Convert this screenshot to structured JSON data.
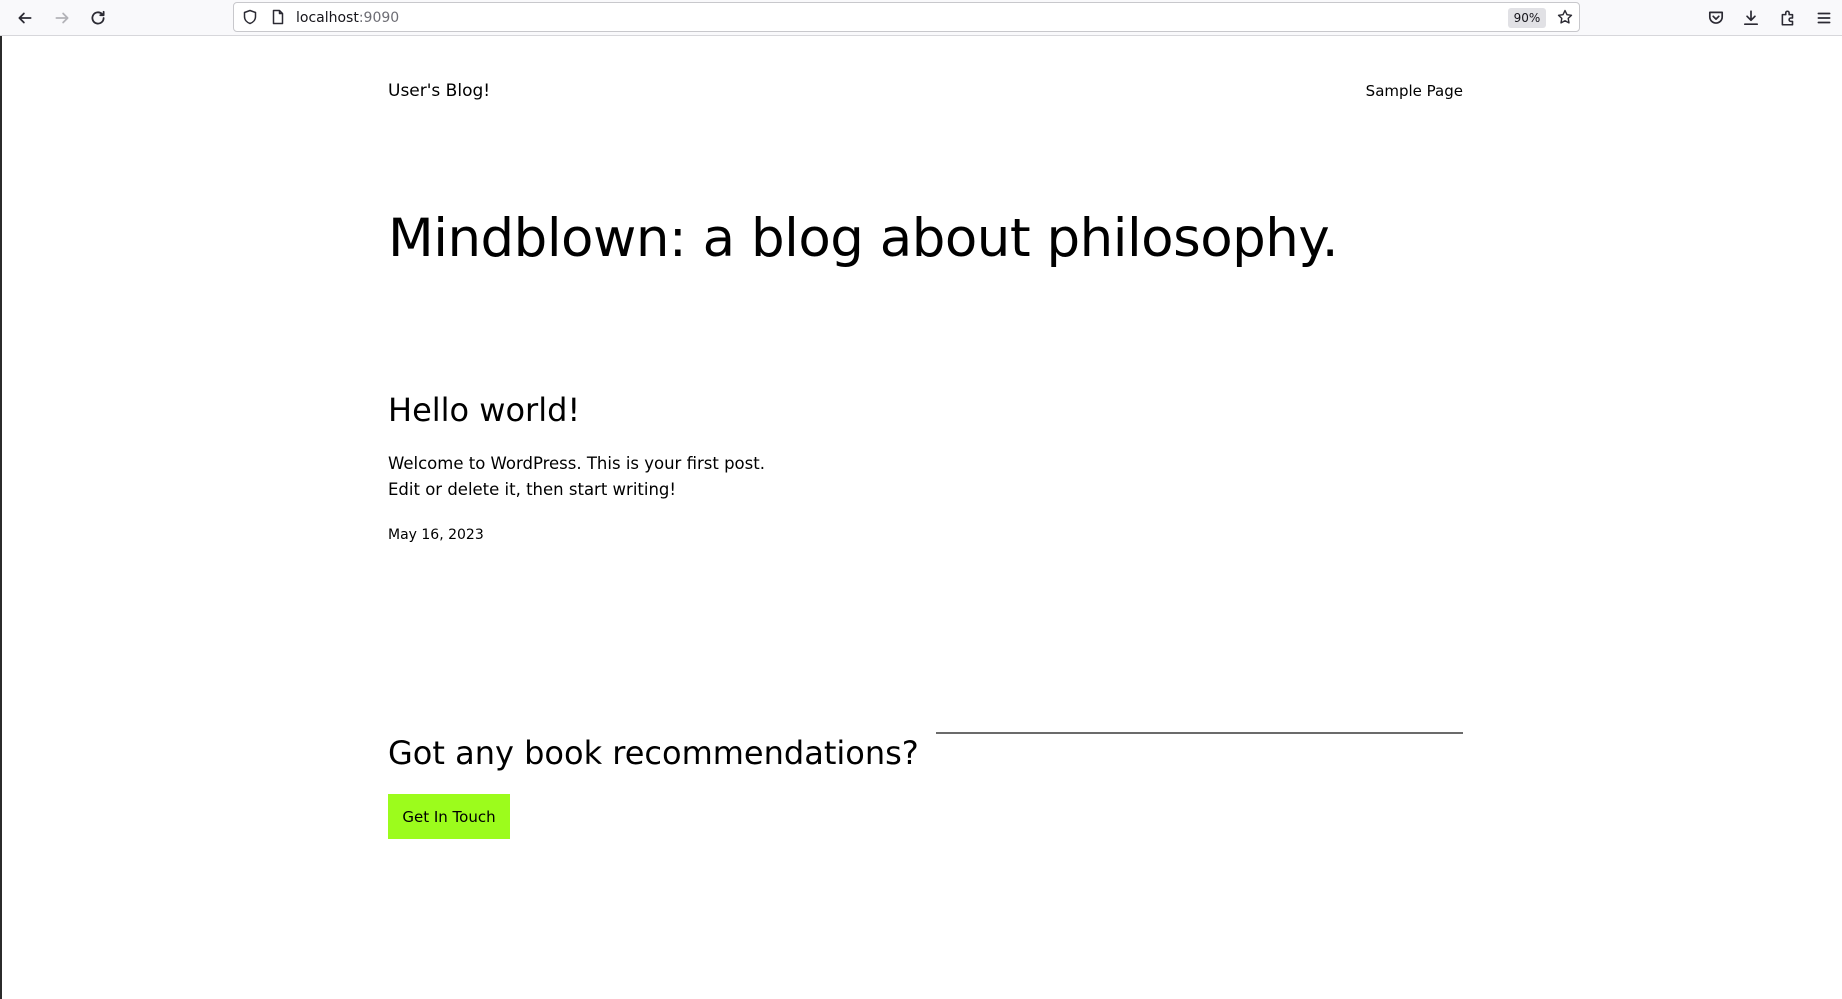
{
  "browser": {
    "url_host": "localhost",
    "url_port": ":9090",
    "zoom": "90%",
    "icons": [
      "back-icon",
      "forward-icon",
      "reload-icon",
      "shield-icon",
      "page-icon",
      "bookmark-star-icon",
      "pocket-icon",
      "download-icon",
      "extensions-icon",
      "menu-icon"
    ]
  },
  "site": {
    "title": "User's Blog!",
    "nav": [
      "Sample Page"
    ]
  },
  "hero": {
    "heading": "Mindblown: a blog about philosophy."
  },
  "post": {
    "title": "Hello world!",
    "excerpt": "Welcome to WordPress. This is your first post. Edit or delete it, then start writing!",
    "date": "May 16, 2023"
  },
  "cta": {
    "heading": "Got any book recommendations?",
    "button": "Get In Touch",
    "button_color": "#9cfc1c"
  }
}
